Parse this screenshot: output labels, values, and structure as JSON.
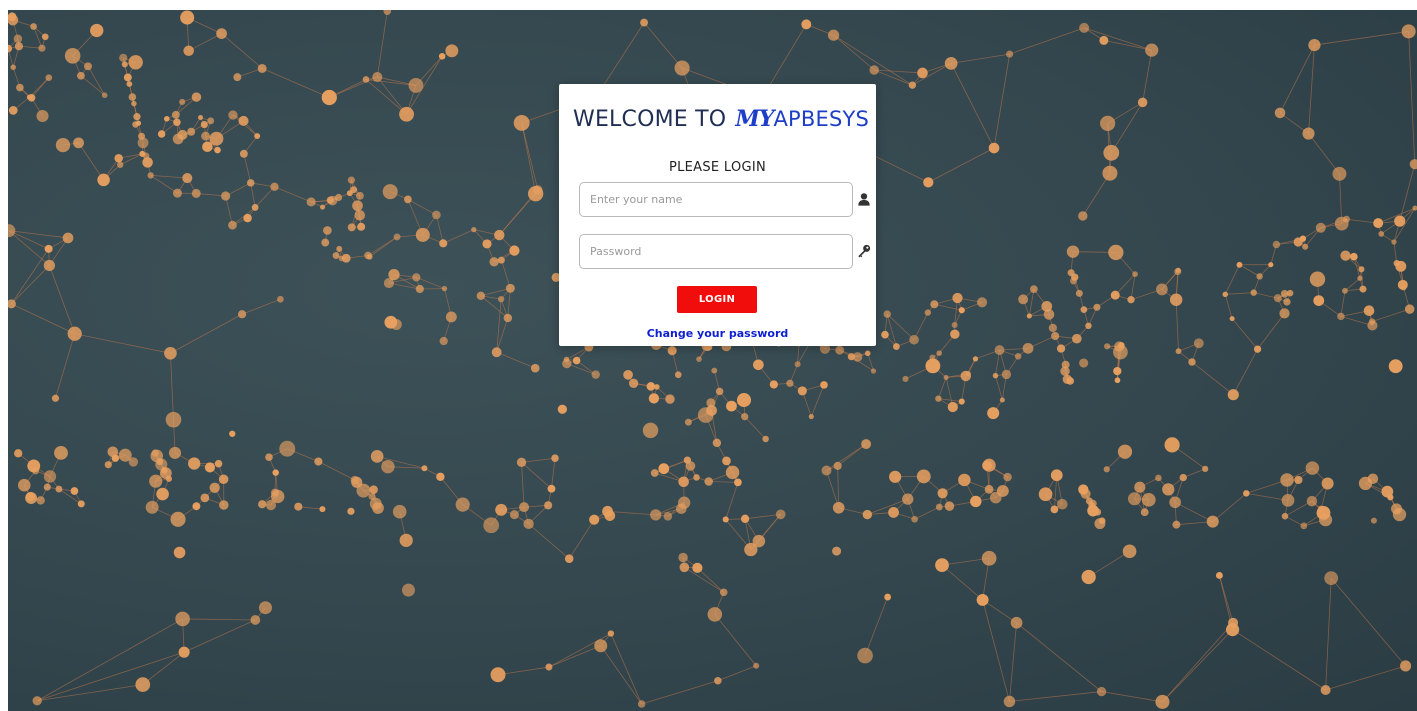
{
  "login_card": {
    "welcome_prefix": "WELCOME TO",
    "brand_my": "MY",
    "brand_name": "APBESYS",
    "subtitle": "PLEASE LOGIN",
    "username_placeholder": "Enter your name",
    "username_value": "",
    "password_placeholder": "Password",
    "password_value": "",
    "username_icon": "user-icon",
    "password_icon": "key-icon",
    "login_label": "LOGIN",
    "change_password_label": "Change your password"
  },
  "colors": {
    "background": "#34474e",
    "network_line": "#c47a4c",
    "network_node": "#e8a060",
    "brand_blue": "#1e3ec8",
    "login_button": "#f20d0d",
    "link": "#0d1fd1"
  }
}
